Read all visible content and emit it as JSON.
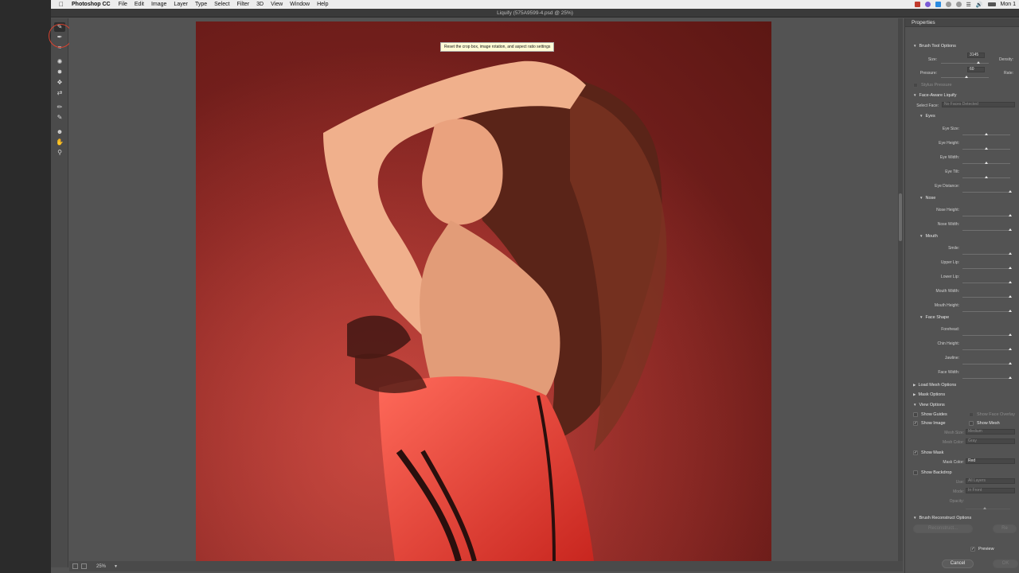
{
  "menubar": {
    "app_name": "Photoshop CC",
    "items": [
      "File",
      "Edit",
      "Image",
      "Layer",
      "Type",
      "Select",
      "Filter",
      "3D",
      "View",
      "Window",
      "Help"
    ],
    "clock": "Mon 1"
  },
  "window": {
    "title": "Liquify (575A9599-4.psd @ 25%)"
  },
  "tooltip": "Reset the crop box, image rotation, and aspect ratio settings",
  "status": {
    "zoom": "25%"
  },
  "panel": {
    "title": "Properties",
    "brush_tool_options": {
      "heading": "Brush Tool Options",
      "size_label": "Size:",
      "size_value": "3145",
      "density_label": "Density:",
      "pressure_label": "Pressure:",
      "pressure_value": "60",
      "rate_label": "Rate:",
      "stylus_label": "Stylus Pressure"
    },
    "face_aware": {
      "heading": "Face-Aware Liquify",
      "select_face_label": "Select Face:",
      "select_face_value": "No Faces Detected",
      "eyes_heading": "Eyes",
      "eyes": [
        "Eye Size:",
        "Eye Height:",
        "Eye Width:",
        "Eye Tilt:",
        "Eye Distance:"
      ],
      "nose_heading": "Nose",
      "nose": [
        "Nose Height:",
        "Nose Width:"
      ],
      "mouth_heading": "Mouth",
      "mouth": [
        "Smile:",
        "Upper Lip:",
        "Lower Lip:",
        "Mouth Width:",
        "Mouth Height:"
      ],
      "face_shape_heading": "Face Shape",
      "face_shape": [
        "Forehead:",
        "Chin Height:",
        "Jawline:",
        "Face Width:"
      ]
    },
    "load_mesh": "Load Mesh Options",
    "mask_options": "Mask Options",
    "view_options": {
      "heading": "View Options",
      "show_guides": "Show Guides",
      "show_face_overlay": "Show Face Overlay",
      "show_image": "Show Image",
      "show_mesh": "Show Mesh",
      "mesh_size_label": "Mesh Size:",
      "mesh_size_value": "Medium",
      "mesh_color_label": "Mesh Color:",
      "mesh_color_value": "Gray",
      "show_mask": "Show Mask",
      "mask_color_label": "Mask Color:",
      "mask_color_value": "Red",
      "show_backdrop": "Show Backdrop",
      "use_label": "Use:",
      "use_value": "All Layers",
      "mode_label": "Mode:",
      "mode_value": "In Front",
      "opacity_label": "Opacity:"
    },
    "reconstruct": {
      "heading": "Brush Reconstruct Options",
      "reconstruct_button": "Reconstruct...",
      "restore_button": "Re"
    },
    "preview_label": "Preview",
    "cancel_label": "Cancel",
    "ok_label": "OK"
  },
  "colors": {
    "accent_ring": "#d8422f",
    "panel_bg": "#535353",
    "canvas_bg": "#535353"
  }
}
